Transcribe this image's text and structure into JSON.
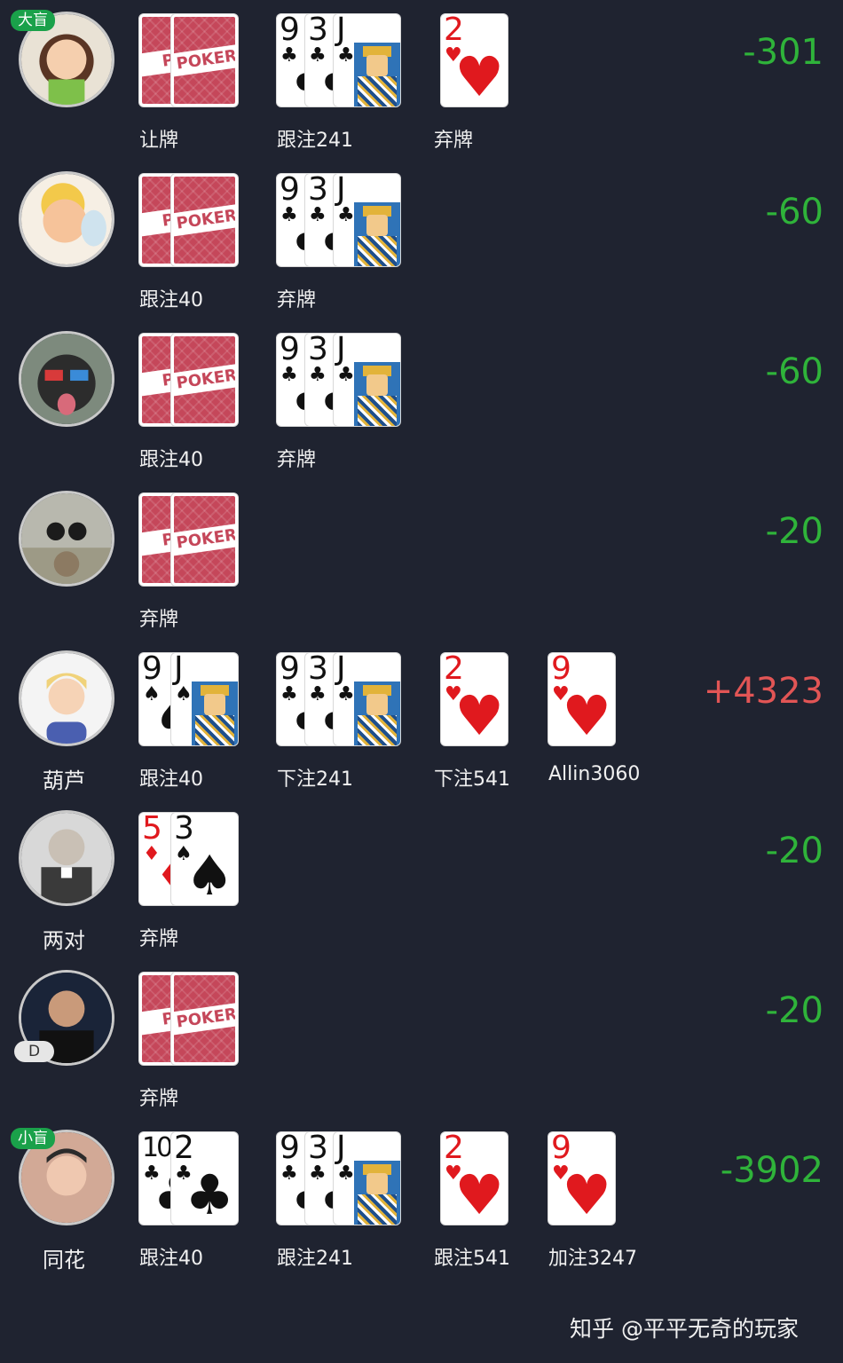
{
  "players": [
    {
      "role": "大盲",
      "name": "",
      "avatar": "girl-avatar",
      "score": "-301",
      "score_sign": "neg",
      "stages": [
        {
          "label": "让牌",
          "cards": [
            {
              "back": true,
              "logo": "PO"
            },
            {
              "back": true,
              "logo": "POKER"
            }
          ]
        },
        {
          "label": "跟注241",
          "cards": [
            {
              "rank": "9",
              "suit": "♣",
              "color": "black"
            },
            {
              "rank": "3",
              "suit": "♣",
              "color": "black"
            },
            {
              "rank": "J",
              "suit": "♣",
              "color": "black",
              "face": true
            }
          ]
        },
        {
          "label": "弃牌",
          "cards": [
            {
              "rank": "2",
              "suit": "♥",
              "color": "red"
            }
          ]
        }
      ]
    },
    {
      "role": "",
      "name": "",
      "avatar": "cupid-avatar",
      "score": "-60",
      "score_sign": "neg",
      "stages": [
        {
          "label": "跟注40",
          "cards": [
            {
              "back": true,
              "logo": "PO"
            },
            {
              "back": true,
              "logo": "POKER"
            }
          ]
        },
        {
          "label": "弃牌",
          "cards": [
            {
              "rank": "9",
              "suit": "♣",
              "color": "black"
            },
            {
              "rank": "3",
              "suit": "♣",
              "color": "black"
            },
            {
              "rank": "J",
              "suit": "♣",
              "color": "black",
              "face": true
            }
          ]
        }
      ]
    },
    {
      "role": "",
      "name": "",
      "avatar": "gorilla-avatar",
      "score": "-60",
      "score_sign": "neg",
      "stages": [
        {
          "label": "跟注40",
          "cards": [
            {
              "back": true,
              "logo": "PO"
            },
            {
              "back": true,
              "logo": "POKER"
            }
          ]
        },
        {
          "label": "弃牌",
          "cards": [
            {
              "rank": "9",
              "suit": "♣",
              "color": "black"
            },
            {
              "rank": "3",
              "suit": "♣",
              "color": "black"
            },
            {
              "rank": "J",
              "suit": "♣",
              "color": "black",
              "face": true
            }
          ]
        }
      ]
    },
    {
      "role": "",
      "name": "",
      "avatar": "dogs-cat-avatar",
      "score": "-20",
      "score_sign": "neg",
      "stages": [
        {
          "label": "弃牌",
          "cards": [
            {
              "back": true,
              "logo": "PO"
            },
            {
              "back": true,
              "logo": "POKER"
            }
          ]
        }
      ]
    },
    {
      "role": "",
      "name": "葫芦",
      "avatar": "boy-avatar",
      "score": "+4323",
      "score_sign": "pos",
      "stages": [
        {
          "label": "跟注40",
          "cards": [
            {
              "rank": "9",
              "suit": "♠",
              "color": "black"
            },
            {
              "rank": "J",
              "suit": "♠",
              "color": "black",
              "face": true
            }
          ]
        },
        {
          "label": "下注241",
          "cards": [
            {
              "rank": "9",
              "suit": "♣",
              "color": "black"
            },
            {
              "rank": "3",
              "suit": "♣",
              "color": "black"
            },
            {
              "rank": "J",
              "suit": "♣",
              "color": "black",
              "face": true
            }
          ]
        },
        {
          "label": "下注541",
          "cards": [
            {
              "rank": "2",
              "suit": "♥",
              "color": "red"
            }
          ]
        },
        {
          "label": "Allin3060",
          "cards": [
            {
              "rank": "9",
              "suit": "♥",
              "color": "red"
            }
          ]
        }
      ]
    },
    {
      "role": "",
      "name": "两对",
      "avatar": "old-man-avatar",
      "score": "-20",
      "score_sign": "neg",
      "stages": [
        {
          "label": "弃牌",
          "cards": [
            {
              "rank": "5",
              "suit": "♦",
              "color": "red"
            },
            {
              "rank": "3",
              "suit": "♠",
              "color": "black"
            }
          ]
        }
      ]
    },
    {
      "role": "D",
      "name": "",
      "avatar": "man-avatar",
      "score": "-20",
      "score_sign": "neg",
      "stages": [
        {
          "label": "弃牌",
          "cards": [
            {
              "back": true,
              "logo": "PO"
            },
            {
              "back": true,
              "logo": "POKER"
            }
          ]
        }
      ]
    },
    {
      "role": "小盲",
      "name": "同花",
      "avatar": "young-man-avatar",
      "score": "-3902",
      "score_sign": "neg",
      "stages": [
        {
          "label": "跟注40",
          "cards": [
            {
              "rank": "10",
              "suit": "♣",
              "color": "black"
            },
            {
              "rank": "2",
              "suit": "♣",
              "color": "black"
            }
          ]
        },
        {
          "label": "跟注241",
          "cards": [
            {
              "rank": "9",
              "suit": "♣",
              "color": "black"
            },
            {
              "rank": "3",
              "suit": "♣",
              "color": "black"
            },
            {
              "rank": "J",
              "suit": "♣",
              "color": "black",
              "face": true
            }
          ]
        },
        {
          "label": "跟注541",
          "cards": [
            {
              "rank": "2",
              "suit": "♥",
              "color": "red"
            }
          ]
        },
        {
          "label": "加注3247",
          "cards": [
            {
              "rank": "9",
              "suit": "♥",
              "color": "red"
            }
          ]
        }
      ]
    }
  ],
  "watermark": "知乎 @平平无奇的玩家",
  "colors": {
    "background": "#1f2330",
    "loss": "#2fb33a",
    "win": "#e25555",
    "badge": "#1aa14a",
    "card_back": "#c5475a"
  }
}
